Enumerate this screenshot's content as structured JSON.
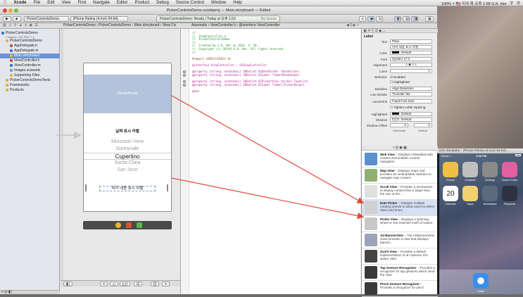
{
  "menubar": {
    "apple": "",
    "app": "Xcode",
    "menus": [
      "File",
      "Edit",
      "View",
      "Find",
      "Navigate",
      "Editor",
      "Product",
      "Debug",
      "Source Control",
      "Window",
      "Help"
    ],
    "right_text": "100% ⚡ 🇺🇸 미국 목 오후 1:58  G.K. Her",
    "user": "G.K. Her"
  },
  "window": {
    "title": "PickerControlsDemo.xcodeproj — Main.storyboard — Edited",
    "scheme": "PickerControlsDemo",
    "device": "iPhone Retina (4-inch 64-bit)",
    "activity_left": "PickerControlsDemo: Ready  |  Today at 오후 1:53",
    "activity_right": "No Issues",
    "breadcrumb_left": "PickerControlsDemo  ›  PickerControlsDemo  ›  Main.storyboard  ›  View Controller Scene  ›  View Controller  ›  View  ›  Label - 피커 내용 표시 라벨",
    "breadcrumb_right": "Automatic  ›  ViewController.h  ›  @interface ViewController"
  },
  "navigator": {
    "items": [
      {
        "label": "PickerControlsDemo",
        "sub": "2 targets, iOS SDK 7.1",
        "indent": 2,
        "color": "#3c6fc8",
        "selected": false
      },
      {
        "label": "PickerControlsDemo",
        "indent": 8,
        "color": "#e2b04a",
        "selected": false
      },
      {
        "label": "AppDelegate.h",
        "indent": 14,
        "color": "#c45050",
        "selected": false
      },
      {
        "label": "AppDelegate.m",
        "indent": 14,
        "color": "#4a6ccf",
        "selected": false
      },
      {
        "label": "Main.storyboard",
        "indent": 14,
        "color": "#d8c040",
        "selected": true
      },
      {
        "label": "ViewController.h",
        "indent": 14,
        "color": "#c45050",
        "selected": false
      },
      {
        "label": "ViewController.m",
        "indent": 14,
        "color": "#4a6ccf",
        "selected": false
      },
      {
        "label": "Images.xcassets",
        "indent": 14,
        "color": "#6ca0d8",
        "selected": false
      },
      {
        "label": "Supporting Files",
        "indent": 14,
        "color": "#e2b04a",
        "selected": false
      },
      {
        "label": "PickerControlsDemoTests",
        "indent": 8,
        "color": "#e2b04a",
        "selected": false
      },
      {
        "label": "Frameworks",
        "indent": 8,
        "color": "#e2b04a",
        "selected": false
      },
      {
        "label": "Products",
        "indent": 8,
        "color": "#e2b04a",
        "selected": false
      }
    ]
  },
  "storyboard": {
    "date_picker_label": "UIDatePicker",
    "date_label": "날짜 표시 라벨",
    "picker_rows": [
      "Mountain View",
      "Sunnyvale",
      "Cupertino",
      "Santa Clara",
      "San Jose"
    ],
    "picker_label": "피커 내용 표시 라벨",
    "zoom_buttons": [
      "=",
      "◻",
      "|◻|",
      "⊡",
      "Q",
      "="
    ]
  },
  "code": {
    "lines": [
      "//",
      "//  ViewController.h",
      "//  PickerControlsDemo",
      "//",
      "//  Created by G.K. Her on 2014. 4. 28..",
      "//  Copyright (c) 2014년 G.K. Her. All rights reserved.",
      "//",
      "",
      "#import <UIKit/UIKit.h>",
      "",
      "@interface ViewController : UIViewController",
      "",
      "@property (strong, nonatomic) IBOutlet UIDatePicker *datePicker;",
      "@property (strong, nonatomic) IBOutlet UILabel *labelDateOutput;",
      "",
      "@property (strong, nonatomic) IBOutlet UIPickerView *picker_TownList;",
      "@property (strong, nonatomic) IBOutlet UILabel *label_PickerOutput;",
      "",
      "@end"
    ]
  },
  "inspector": {
    "section": "Label",
    "text": "Plain",
    "text_value": "피커 내용 표시 라벨",
    "color": "Default",
    "font": "System 17.0",
    "alignment": "Alignment",
    "lines": "1",
    "behavior": "Enabled",
    "highlighted": "Highlighted",
    "baseline": "Align Baselines",
    "line_breaks": "Truncate Tail",
    "autoshrink": "Fixed Font Size",
    "tighten": "Tighten Letter Spacing",
    "highlighted_color": "Default",
    "shadow": "Default",
    "shadow_offset_h": "0",
    "shadow_offset_v": "-1",
    "horizontal": "Horizontal",
    "vertical": "Vertical",
    "labels": {
      "text": "Text",
      "color": "Color",
      "font": "Font",
      "alignment": "Alignment",
      "lines": "Lines",
      "behavior": "Behavior",
      "baseline": "Baseline",
      "line_breaks": "Line Breaks",
      "autoshrink": "Autoshrink",
      "highlighted": "Highlighted",
      "shadow": "Shadow",
      "shadow_offset": "Shadow Offset"
    }
  },
  "library": {
    "items": [
      {
        "name": "Web View",
        "desc": "Displays embedded web content and enables content navigation.",
        "color": "#5a8fd0"
      },
      {
        "name": "Map View",
        "desc": "Displays maps and provides an embeddable interface to navigate map content.",
        "color": "#8fb070"
      },
      {
        "name": "Scroll View",
        "desc": "Provides a mechanism to display content that is larger than the size of the ...",
        "color": "#e0e0e0"
      },
      {
        "name": "Date Picker",
        "desc": "Displays multiple rotating wheels to allow users to select dates and times.",
        "color": "#d0d0d0"
      },
      {
        "name": "Picker View",
        "desc": "Displays a spinning-wheel or slot-machine motif of values.",
        "color": "#c8c8c8"
      },
      {
        "name": "Ad BannerView",
        "desc": "The ADBannerView class provides a view that displays banner...",
        "color": "#9aa4b8"
      },
      {
        "name": "GLKit View",
        "desc": "Provides a default implementation of an OpenGL ES-aware view.",
        "color": "#444"
      },
      {
        "name": "Tap Gesture Recognizer",
        "desc": "Provides a recognizer for tap gestures which send the view.",
        "color": "#3a3a3a"
      },
      {
        "name": "Pinch Gesture Recognizer",
        "desc": "Provides a recognizer for pinch",
        "color": "#3a3a3a"
      }
    ]
  },
  "simulator": {
    "title": "iOS Simulator - iPhone Retina (4-inch 64-bit) ...",
    "carrier": "Carrier ≈",
    "time": "1:58 PM",
    "apps": [
      {
        "label": "Photos",
        "color": "#f0c040"
      },
      {
        "label": "Contacts",
        "color": "#bfbfbf"
      },
      {
        "label": "Settings",
        "color": "#8a8a8a"
      },
      {
        "label": "Game Center",
        "color": "#e060a0"
      },
      {
        "label": "Calendar",
        "color": "#ffffff"
      },
      {
        "label": "Maps",
        "color": "#f2d070"
      },
      {
        "label": "Newsstand",
        "color": "#5a6b7d"
      },
      {
        "label": "Passbook",
        "color": "#2c3240"
      }
    ],
    "calendar_day": "20",
    "dock_label": "Safari"
  },
  "colors": {
    "selection": "#6b93d4",
    "arrow": "#e04a3a"
  }
}
